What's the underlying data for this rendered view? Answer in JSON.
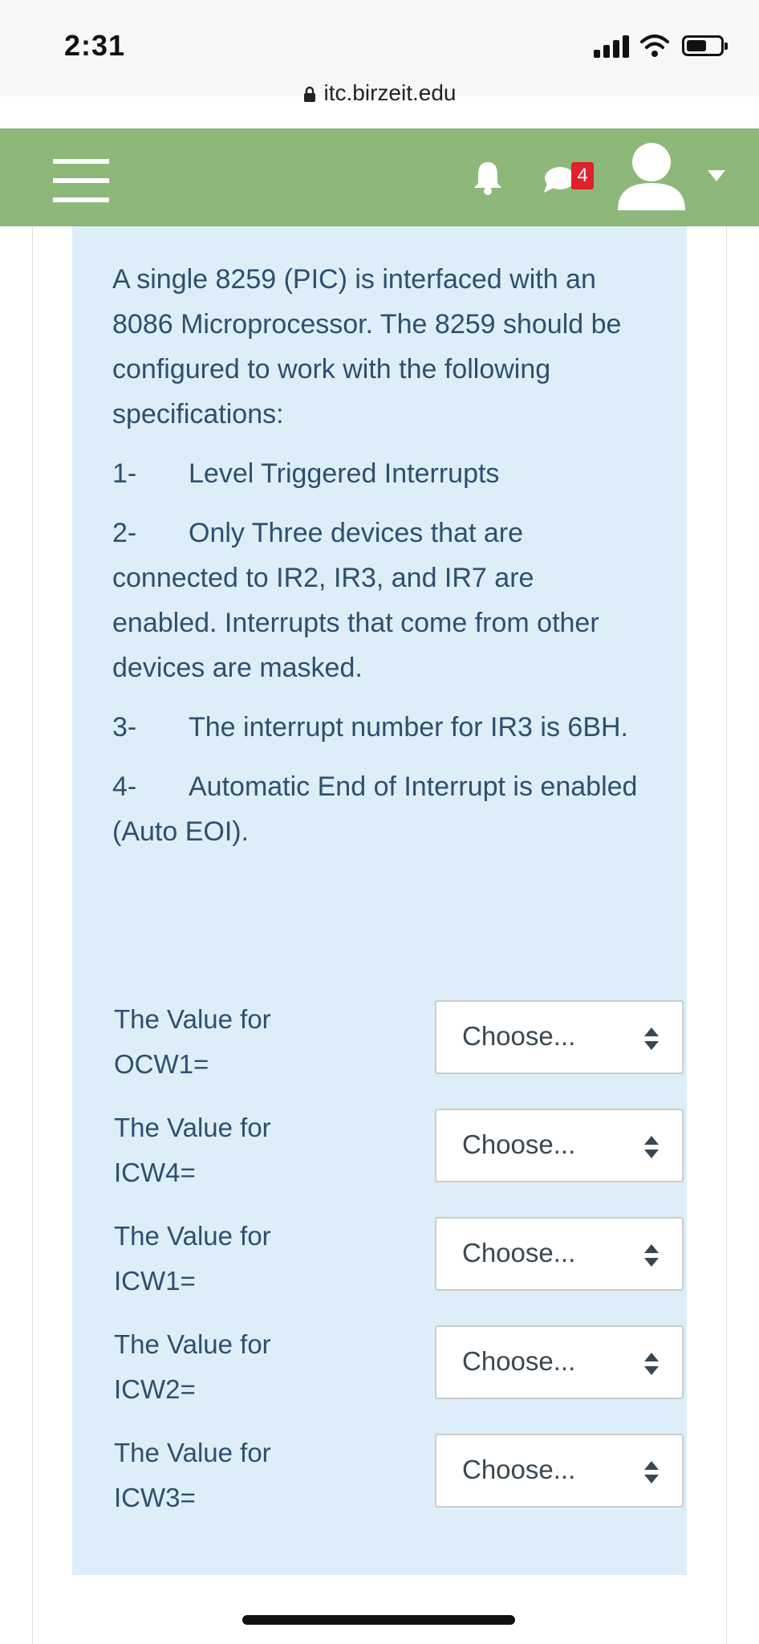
{
  "status_bar": {
    "time": "2:31",
    "url": "itc.birzeit.edu"
  },
  "header": {
    "message_count": "4",
    "brand_color": "#8db87a",
    "badge_color": "#e0202a"
  },
  "question": {
    "intro": "A single 8259 (PIC) is interfaced with an 8086 Microprocessor. The 8259 should be configured to work with the following specifications:",
    "specs": [
      {
        "num": "1-",
        "text": "Level Triggered Interrupts"
      },
      {
        "num": "2-",
        "text": "Only Three devices that are connected to IR2, IR3, and IR7 are enabled. Interrupts that come from other devices are masked."
      },
      {
        "num": "3-",
        "text": "The interrupt number for IR3 is 6BH."
      },
      {
        "num": "4-",
        "text": "Automatic End of Interrupt is enabled (Auto EOI)."
      }
    ],
    "answers": [
      {
        "label": "The Value for OCW1=",
        "value": "Choose..."
      },
      {
        "label": "The Value for ICW4=",
        "value": "Choose..."
      },
      {
        "label": "The Value for ICW1=",
        "value": "Choose..."
      },
      {
        "label": "The Value for ICW2=",
        "value": "Choose..."
      },
      {
        "label": "The Value for ICW3=",
        "value": "Choose..."
      }
    ]
  },
  "icons": {
    "menu": "hamburger-icon",
    "notifications": "bell-icon",
    "messages": "chat-bubble-icon",
    "user": "user-avatar-icon",
    "dropdown": "caret-down-icon",
    "select": "up-down-arrows-icon"
  }
}
